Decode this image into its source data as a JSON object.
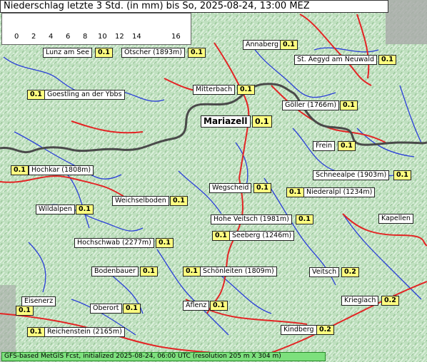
{
  "header": {
    "title": "Niederschlag letzte 3 Std. (in mm) bis So, 2025-08-24, 13:00 MEZ"
  },
  "legend": {
    "ticks": [
      "0",
      "2",
      "4",
      "6",
      "8",
      "10",
      "12",
      "14",
      "16"
    ],
    "colors": [
      "#999999",
      "#c0ffc0",
      "#00dd00",
      "#00c000",
      "#00a000",
      "#008000",
      "#f0c8f0",
      "#e8a8e8",
      "#e088e0",
      "#ff2ad4"
    ]
  },
  "places": [
    {
      "name": "Annaberg",
      "value": "0.1"
    },
    {
      "name": "Lunz am See",
      "value": "0.1"
    },
    {
      "name": "Ötscher (1893m)",
      "value": "0.1"
    },
    {
      "name": "St. Aegyd am Neuwald",
      "value": "0.1"
    },
    {
      "name": "Goestling an der Ybbs",
      "value": "0.1"
    },
    {
      "name": "Mitterbach",
      "value": "0.1"
    },
    {
      "name": "Göller (1766m)",
      "value": "0.1"
    },
    {
      "name": "Mariazell",
      "value": "0.1"
    },
    {
      "name": "Frein",
      "value": "0.1"
    },
    {
      "name": "Hochkar (1808m)",
      "value": "0.1"
    },
    {
      "name": "Schneealpe (1903m)",
      "value": "0.1"
    },
    {
      "name": "Wegscheid",
      "value": "0.1"
    },
    {
      "name": "Niederalpl (1234m)",
      "value": "0.1"
    },
    {
      "name": "Weichselboden",
      "value": "0.1"
    },
    {
      "name": "Wildalpen",
      "value": "0.1"
    },
    {
      "name": "Hohe Veitsch (1981m)",
      "value": "0.1"
    },
    {
      "name": "Kapellen",
      "value": ""
    },
    {
      "name": "Seeberg (1246m)",
      "value": "0.1"
    },
    {
      "name": "Hochschwab (2277m)",
      "value": "0.1"
    },
    {
      "name": "Bodenbauer",
      "value": "0.1"
    },
    {
      "name": "Schönleiten (1809m)",
      "value": "0.1"
    },
    {
      "name": "Veitsch",
      "value": "0.2"
    },
    {
      "name": "Eisenerz",
      "value": "0.1"
    },
    {
      "name": "Oberort",
      "value": "0.1"
    },
    {
      "name": "Aflenz",
      "value": "0.1"
    },
    {
      "name": "Krieglach",
      "value": "0.2"
    },
    {
      "name": "Reichenstein (2165m)",
      "value": "0.1"
    },
    {
      "name": "Kindberg",
      "value": "0.2"
    }
  ],
  "footer": {
    "text": "GFS-based MetGIS Fcst, initialized 2025-08-24, 06:00 UTC  (resolution 205 m X 304 m)"
  }
}
